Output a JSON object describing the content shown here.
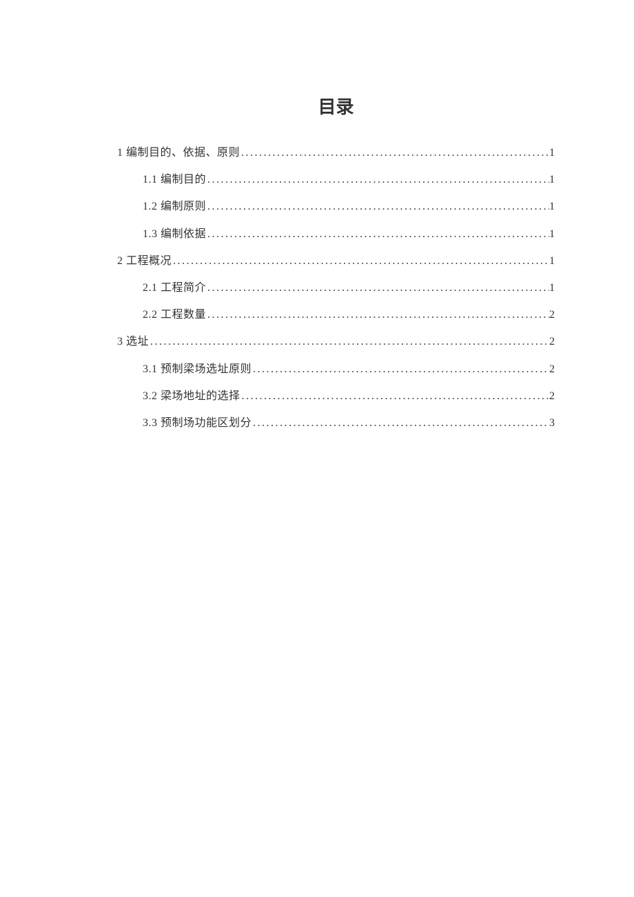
{
  "title": "目录",
  "entries": [
    {
      "level": 1,
      "label": "1 编制目的、依据、原则",
      "page": "1"
    },
    {
      "level": 2,
      "label": "1.1 编制目的",
      "page": "1"
    },
    {
      "level": 2,
      "label": "1.2 编制原则",
      "page": "1"
    },
    {
      "level": 2,
      "label": "1.3 编制依据",
      "page": "1"
    },
    {
      "level": 1,
      "label": "2 工程概况",
      "page": "1"
    },
    {
      "level": 2,
      "label": "2.1 工程简介",
      "page": "1"
    },
    {
      "level": 2,
      "label": "2.2 工程数量",
      "page": "2"
    },
    {
      "level": 1,
      "label": "3 选址",
      "page": "2"
    },
    {
      "level": 2,
      "label": "3.1 预制梁场选址原则",
      "page": "2"
    },
    {
      "level": 2,
      "label": "3.2 梁场地址的选择",
      "page": "2"
    },
    {
      "level": 2,
      "label": "3.3 预制场功能区划分",
      "page": "3"
    }
  ]
}
